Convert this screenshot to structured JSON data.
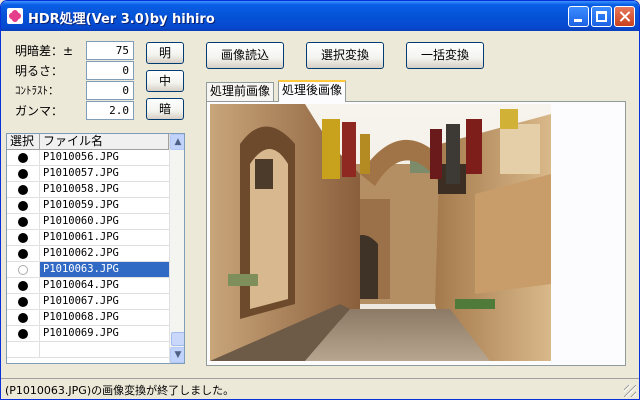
{
  "window": {
    "title": "HDR処理(Ver 3.0)by hihiro"
  },
  "params": [
    {
      "label": "明暗差：±",
      "value": "75"
    },
    {
      "label": "明るさ：",
      "value": "0"
    },
    {
      "label": "ｺﾝﾄﾗｽﾄ：",
      "value": "0"
    },
    {
      "label": "ガンマ：",
      "value": "2.0"
    }
  ],
  "side_buttons": {
    "bright": "明",
    "middle": "中",
    "dark": "暗"
  },
  "toolbar": {
    "load": "画像読込",
    "convert_selected": "選択変換",
    "convert_all": "一括変換"
  },
  "file_list": {
    "headers": {
      "select": "選択",
      "filename": "ファイル名"
    },
    "rows": [
      {
        "name": "P1010056.JPG"
      },
      {
        "name": "P1010057.JPG"
      },
      {
        "name": "P1010058.JPG"
      },
      {
        "name": "P1010059.JPG"
      },
      {
        "name": "P1010060.JPG"
      },
      {
        "name": "P1010061.JPG"
      },
      {
        "name": "P1010062.JPG"
      },
      {
        "name": "P1010063.JPG",
        "selected": true
      },
      {
        "name": "P1010064.JPG"
      },
      {
        "name": "P1010067.JPG"
      },
      {
        "name": "P1010068.JPG"
      },
      {
        "name": "P1010069.JPG"
      }
    ]
  },
  "tabs": {
    "before": "処理前画像",
    "after": "処理後画像",
    "active": "after"
  },
  "status": {
    "message": "(P1010063.JPG)の画像変換が終了しました。"
  }
}
